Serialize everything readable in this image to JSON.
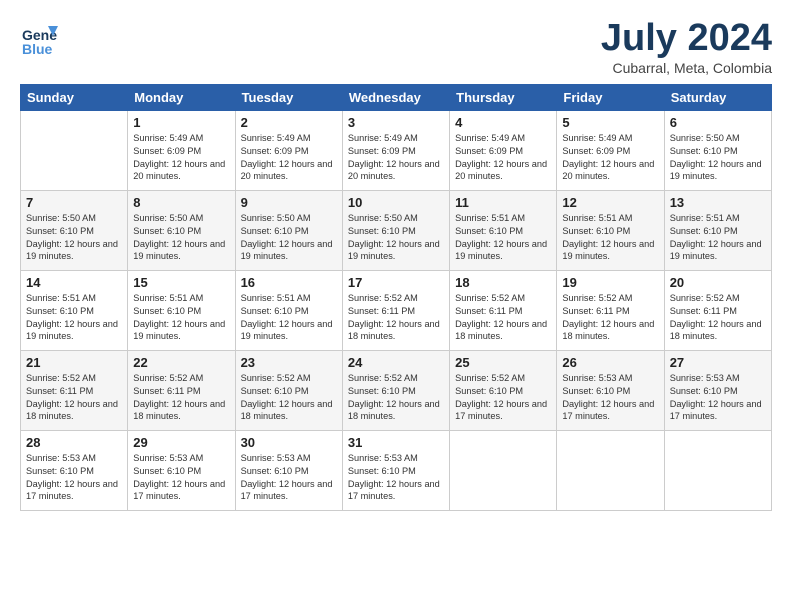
{
  "logo": {
    "line1": "General",
    "line2": "Blue"
  },
  "title": "July 2024",
  "subtitle": "Cubarral, Meta, Colombia",
  "weekdays": [
    "Sunday",
    "Monday",
    "Tuesday",
    "Wednesday",
    "Thursday",
    "Friday",
    "Saturday"
  ],
  "weeks": [
    [
      {
        "day": "",
        "info": ""
      },
      {
        "day": "1",
        "info": "Sunrise: 5:49 AM\nSunset: 6:09 PM\nDaylight: 12 hours\nand 20 minutes."
      },
      {
        "day": "2",
        "info": "Sunrise: 5:49 AM\nSunset: 6:09 PM\nDaylight: 12 hours\nand 20 minutes."
      },
      {
        "day": "3",
        "info": "Sunrise: 5:49 AM\nSunset: 6:09 PM\nDaylight: 12 hours\nand 20 minutes."
      },
      {
        "day": "4",
        "info": "Sunrise: 5:49 AM\nSunset: 6:09 PM\nDaylight: 12 hours\nand 20 minutes."
      },
      {
        "day": "5",
        "info": "Sunrise: 5:49 AM\nSunset: 6:09 PM\nDaylight: 12 hours\nand 20 minutes."
      },
      {
        "day": "6",
        "info": "Sunrise: 5:50 AM\nSunset: 6:10 PM\nDaylight: 12 hours\nand 19 minutes."
      }
    ],
    [
      {
        "day": "7",
        "info": "Sunrise: 5:50 AM\nSunset: 6:10 PM\nDaylight: 12 hours\nand 19 minutes."
      },
      {
        "day": "8",
        "info": "Sunrise: 5:50 AM\nSunset: 6:10 PM\nDaylight: 12 hours\nand 19 minutes."
      },
      {
        "day": "9",
        "info": "Sunrise: 5:50 AM\nSunset: 6:10 PM\nDaylight: 12 hours\nand 19 minutes."
      },
      {
        "day": "10",
        "info": "Sunrise: 5:50 AM\nSunset: 6:10 PM\nDaylight: 12 hours\nand 19 minutes."
      },
      {
        "day": "11",
        "info": "Sunrise: 5:51 AM\nSunset: 6:10 PM\nDaylight: 12 hours\nand 19 minutes."
      },
      {
        "day": "12",
        "info": "Sunrise: 5:51 AM\nSunset: 6:10 PM\nDaylight: 12 hours\nand 19 minutes."
      },
      {
        "day": "13",
        "info": "Sunrise: 5:51 AM\nSunset: 6:10 PM\nDaylight: 12 hours\nand 19 minutes."
      }
    ],
    [
      {
        "day": "14",
        "info": "Sunrise: 5:51 AM\nSunset: 6:10 PM\nDaylight: 12 hours\nand 19 minutes."
      },
      {
        "day": "15",
        "info": "Sunrise: 5:51 AM\nSunset: 6:10 PM\nDaylight: 12 hours\nand 19 minutes."
      },
      {
        "day": "16",
        "info": "Sunrise: 5:51 AM\nSunset: 6:10 PM\nDaylight: 12 hours\nand 19 minutes."
      },
      {
        "day": "17",
        "info": "Sunrise: 5:52 AM\nSunset: 6:11 PM\nDaylight: 12 hours\nand 18 minutes."
      },
      {
        "day": "18",
        "info": "Sunrise: 5:52 AM\nSunset: 6:11 PM\nDaylight: 12 hours\nand 18 minutes."
      },
      {
        "day": "19",
        "info": "Sunrise: 5:52 AM\nSunset: 6:11 PM\nDaylight: 12 hours\nand 18 minutes."
      },
      {
        "day": "20",
        "info": "Sunrise: 5:52 AM\nSunset: 6:11 PM\nDaylight: 12 hours\nand 18 minutes."
      }
    ],
    [
      {
        "day": "21",
        "info": "Sunrise: 5:52 AM\nSunset: 6:11 PM\nDaylight: 12 hours\nand 18 minutes."
      },
      {
        "day": "22",
        "info": "Sunrise: 5:52 AM\nSunset: 6:11 PM\nDaylight: 12 hours\nand 18 minutes."
      },
      {
        "day": "23",
        "info": "Sunrise: 5:52 AM\nSunset: 6:10 PM\nDaylight: 12 hours\nand 18 minutes."
      },
      {
        "day": "24",
        "info": "Sunrise: 5:52 AM\nSunset: 6:10 PM\nDaylight: 12 hours\nand 18 minutes."
      },
      {
        "day": "25",
        "info": "Sunrise: 5:52 AM\nSunset: 6:10 PM\nDaylight: 12 hours\nand 17 minutes."
      },
      {
        "day": "26",
        "info": "Sunrise: 5:53 AM\nSunset: 6:10 PM\nDaylight: 12 hours\nand 17 minutes."
      },
      {
        "day": "27",
        "info": "Sunrise: 5:53 AM\nSunset: 6:10 PM\nDaylight: 12 hours\nand 17 minutes."
      }
    ],
    [
      {
        "day": "28",
        "info": "Sunrise: 5:53 AM\nSunset: 6:10 PM\nDaylight: 12 hours\nand 17 minutes."
      },
      {
        "day": "29",
        "info": "Sunrise: 5:53 AM\nSunset: 6:10 PM\nDaylight: 12 hours\nand 17 minutes."
      },
      {
        "day": "30",
        "info": "Sunrise: 5:53 AM\nSunset: 6:10 PM\nDaylight: 12 hours\nand 17 minutes."
      },
      {
        "day": "31",
        "info": "Sunrise: 5:53 AM\nSunset: 6:10 PM\nDaylight: 12 hours\nand 17 minutes."
      },
      {
        "day": "",
        "info": ""
      },
      {
        "day": "",
        "info": ""
      },
      {
        "day": "",
        "info": ""
      }
    ]
  ]
}
